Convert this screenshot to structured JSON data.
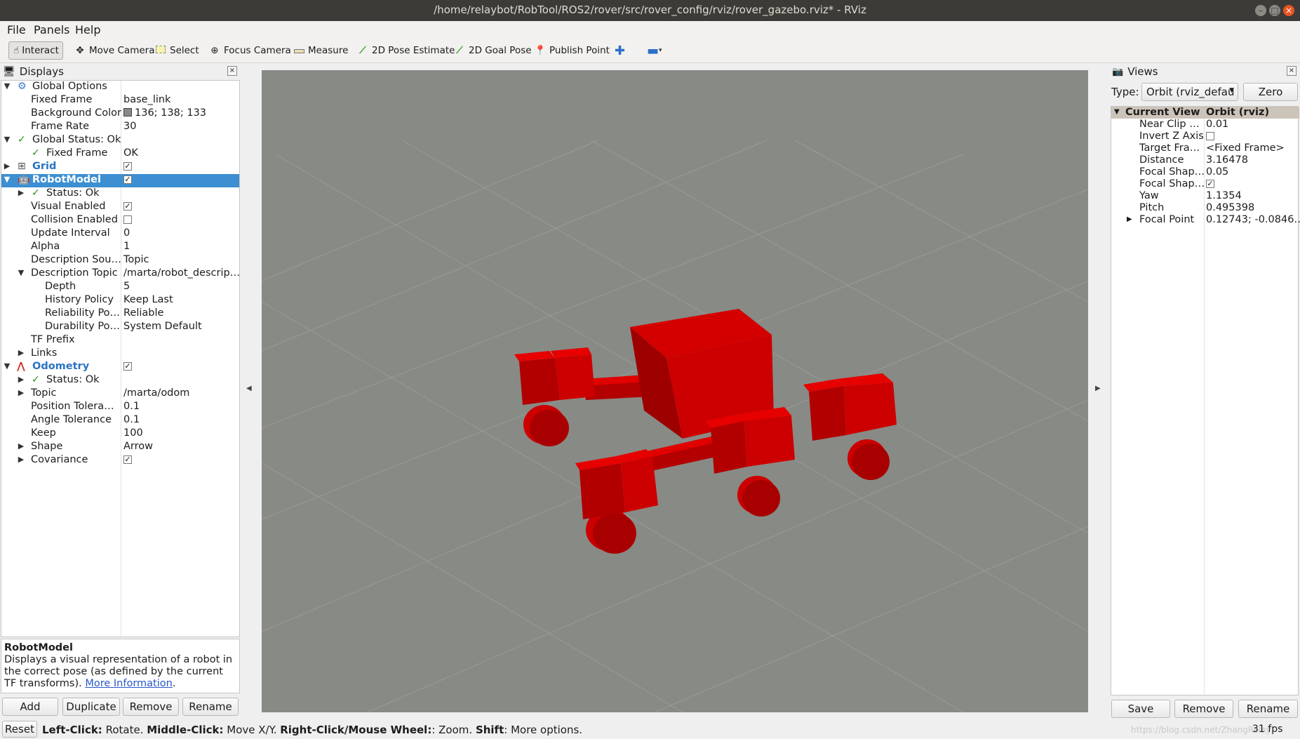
{
  "window": {
    "title": "/home/relaybot/RobTool/ROS2/rover/src/rover_config/rviz/rover_gazebo.rviz* - RViz"
  },
  "menu": [
    "File",
    "Panels",
    "Help"
  ],
  "toolbar": {
    "interact": "Interact",
    "move_camera": "Move Camera",
    "select": "Select",
    "focus_camera": "Focus Camera",
    "measure": "Measure",
    "pose_estimate": "2D Pose Estimate",
    "goal_pose": "2D Goal Pose",
    "publish_point": "Publish Point"
  },
  "displays": {
    "title": "Displays",
    "global_options": "Global Options",
    "fixed_frame_label": "Fixed Frame",
    "fixed_frame_value": "base_link",
    "background_color_label": "Background Color",
    "background_color_value": "136; 138; 133",
    "frame_rate_label": "Frame Rate",
    "frame_rate_value": "30",
    "global_status": "Global Status: Ok",
    "status_fixed_frame_label": "Fixed Frame",
    "status_fixed_frame_value": "OK",
    "grid": "Grid",
    "robot_model": "RobotModel",
    "rm_status": "Status: Ok",
    "visual_enabled": "Visual Enabled",
    "collision_enabled": "Collision Enabled",
    "update_interval_label": "Update Interval",
    "update_interval_value": "0",
    "alpha_label": "Alpha",
    "alpha_value": "1",
    "description_source_label": "Description Sou…",
    "description_source_value": "Topic",
    "description_topic_label": "Description Topic",
    "description_topic_value": "/marta/robot_descrip…",
    "depth_label": "Depth",
    "depth_value": "5",
    "history_label": "History Policy",
    "history_value": "Keep Last",
    "reliability_label": "Reliability Po…",
    "reliability_value": "Reliable",
    "durability_label": "Durability Po…",
    "durability_value": "System Default",
    "tf_prefix": "TF Prefix",
    "links": "Links",
    "odometry": "Odometry",
    "odo_status": "Status: Ok",
    "topic_label": "Topic",
    "topic_value": "/marta/odom",
    "pos_tol_label": "Position Tolera…",
    "pos_tol_value": "0.1",
    "angle_tol_label": "Angle Tolerance",
    "angle_tol_value": "0.1",
    "keep_label": "Keep",
    "keep_value": "100",
    "shape_label": "Shape",
    "shape_value": "Arrow",
    "covariance": "Covariance"
  },
  "description": {
    "title": "RobotModel",
    "text": "Displays a visual representation of a robot in the correct pose (as defined by the current TF transforms).",
    "link": "More Information",
    "link_suffix": "."
  },
  "display_buttons": {
    "add": "Add",
    "duplicate": "Duplicate",
    "remove": "Remove",
    "rename": "Rename"
  },
  "views": {
    "title": "Views",
    "type_label": "Type:",
    "type_value": "Orbit (rviz_defau",
    "zero": "Zero",
    "current_view": "Current View",
    "current_view_type": "Orbit (rviz)",
    "near_clip_label": "Near Clip …",
    "near_clip_value": "0.01",
    "invert_z_label": "Invert Z Axis",
    "target_frame_label": "Target Fra…",
    "target_frame_value": "<Fixed Frame>",
    "distance_label": "Distance",
    "distance_value": "3.16478",
    "focal_shape_size_label": "Focal Shap…",
    "focal_shape_size_value": "0.05",
    "focal_shape_fixed_label": "Focal Shap…",
    "yaw_label": "Yaw",
    "yaw_value": "1.1354",
    "pitch_label": "Pitch",
    "pitch_value": "0.495398",
    "focal_point_label": "Focal Point",
    "focal_point_value": "0.12743; -0.0846…",
    "save": "Save",
    "remove": "Remove",
    "rename": "Rename"
  },
  "statusbar": {
    "reset": "Reset",
    "left_click": "Left-Click:",
    "left_action": " Rotate. ",
    "middle_click": "Middle-Click:",
    "middle_action": " Move X/Y. ",
    "right_click": "Right-Click/Mouse Wheel:",
    "right_action": ": Zoom. ",
    "shift": "Shift",
    "shift_action": ": More options.",
    "fps": "31 fps",
    "watermark": "https://blog.csdn.net/ZhangRelay"
  },
  "colors": {
    "viewport_bg": "#888a85",
    "robot_red": "#cc0000",
    "selection_blue": "#3d8fd1"
  }
}
